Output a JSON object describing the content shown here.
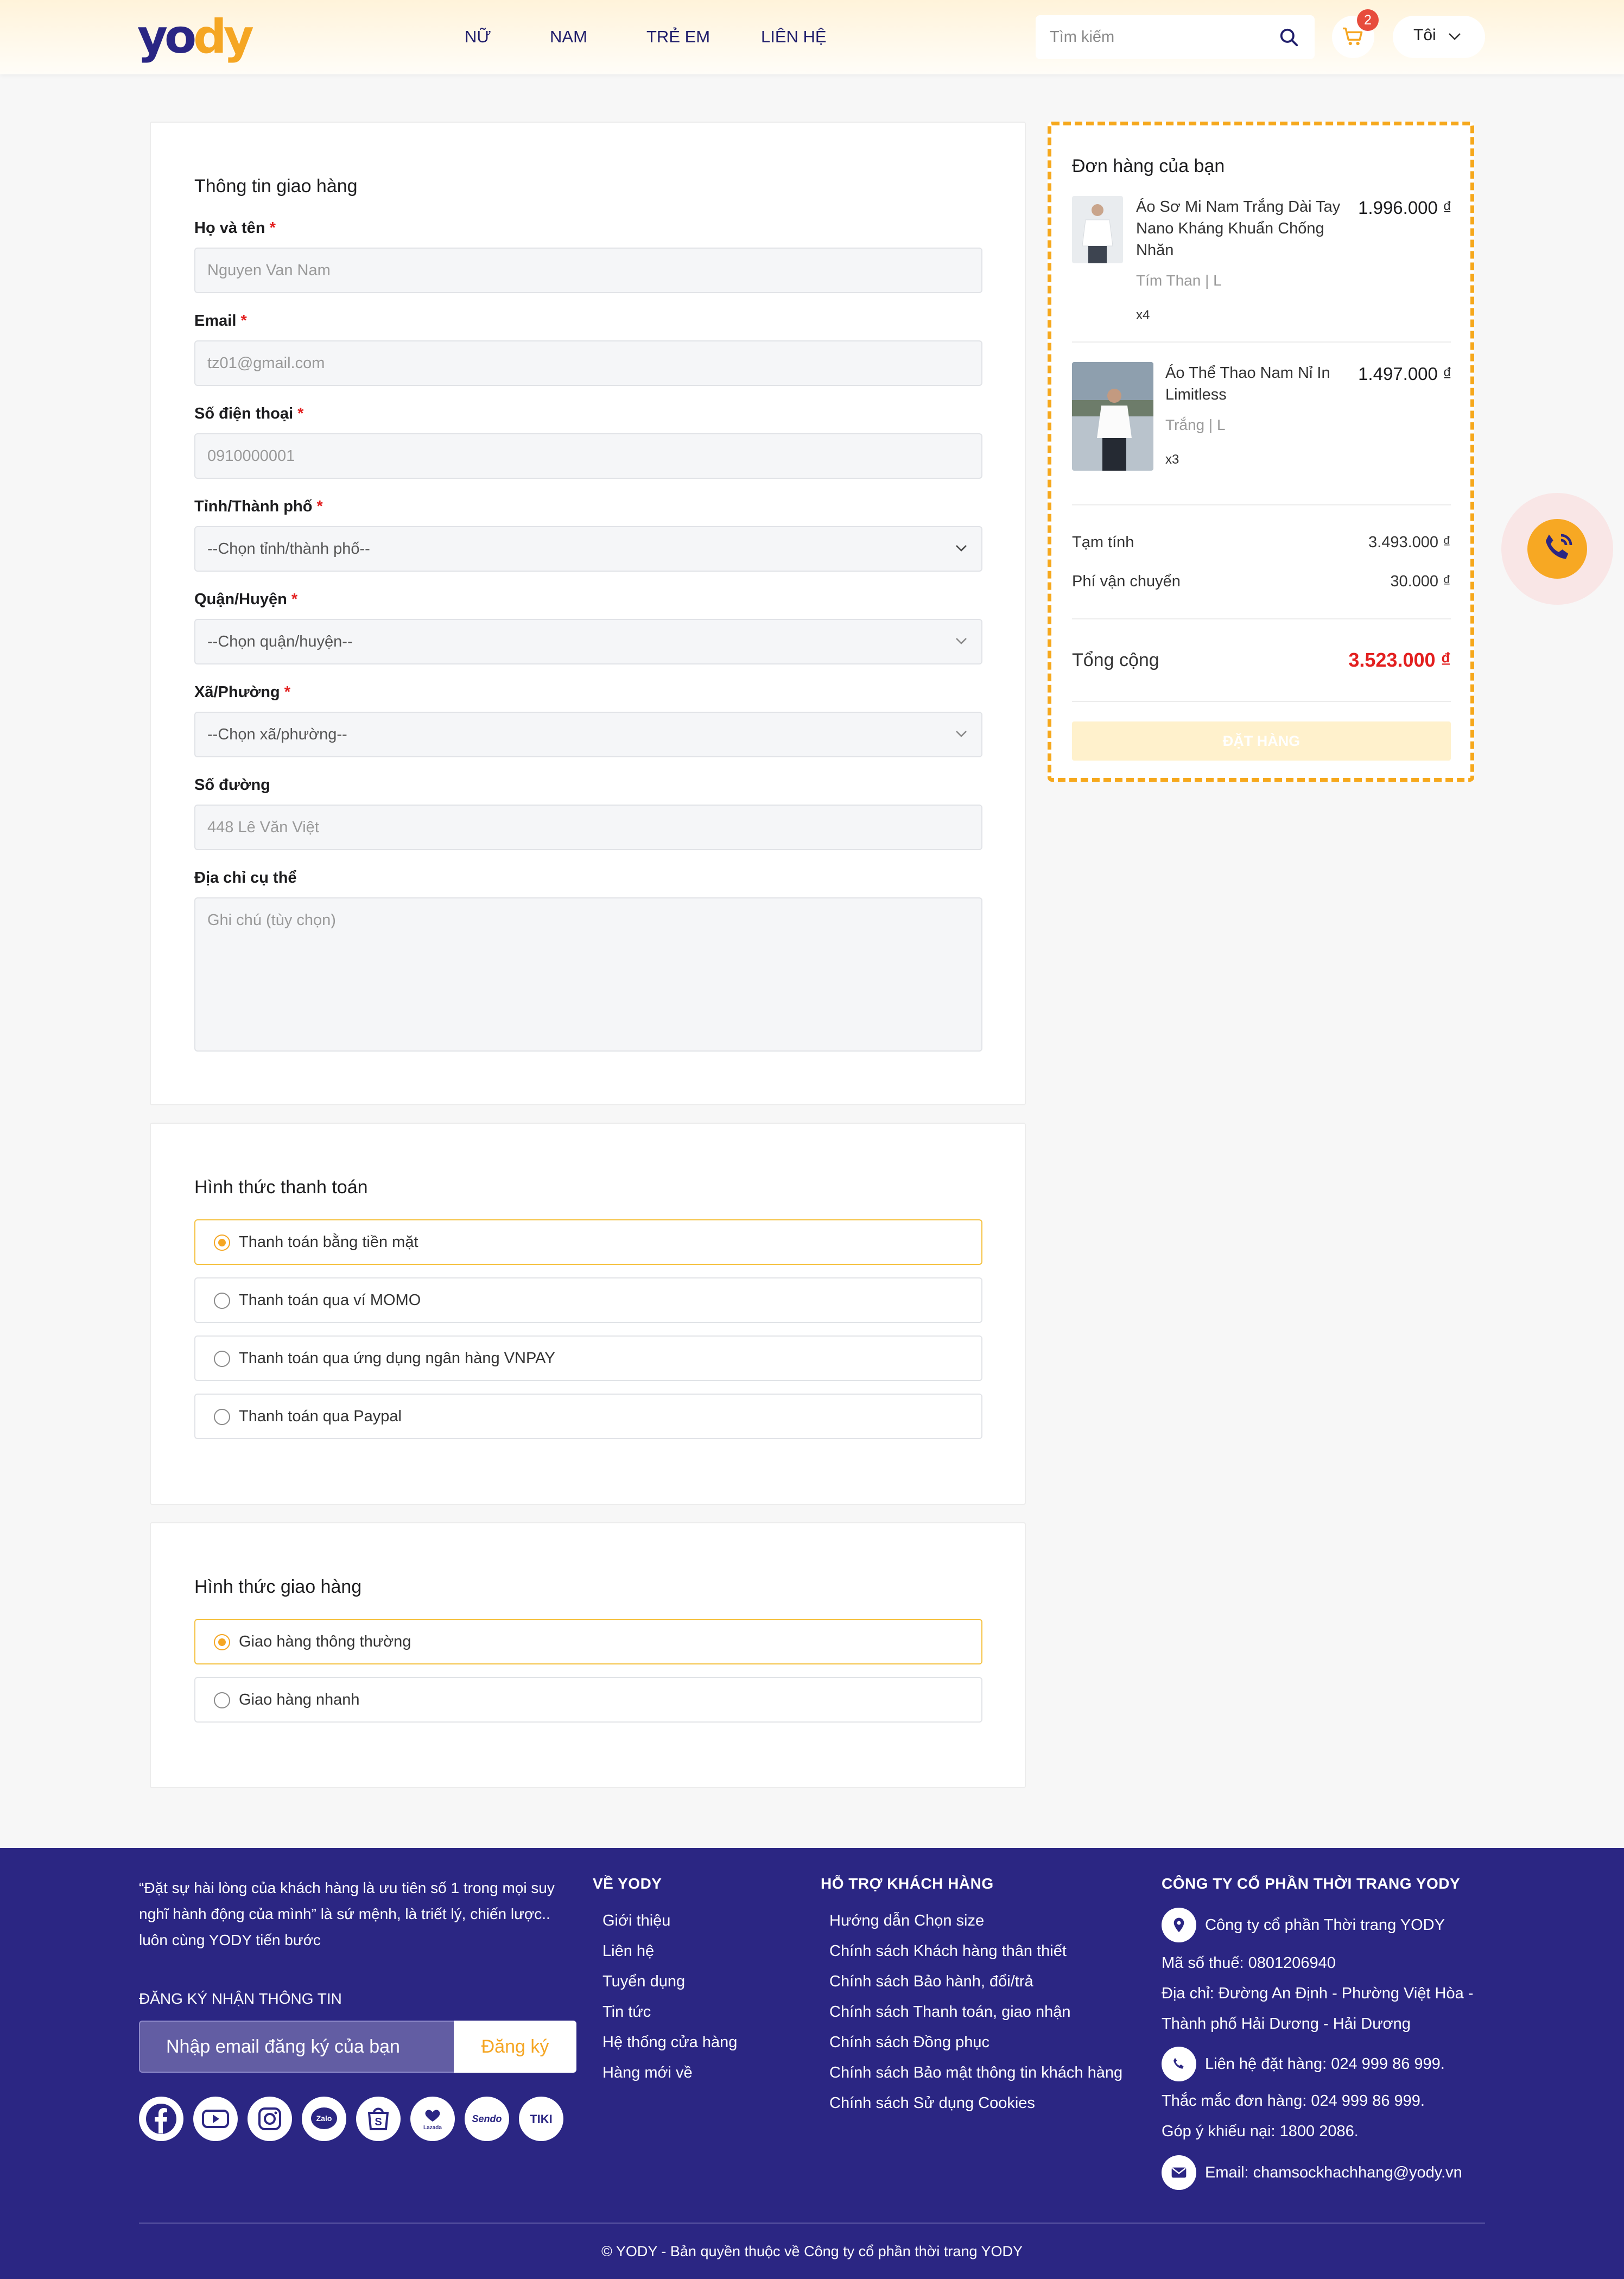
{
  "header": {
    "logo_left": "yo",
    "logo_right": "dy",
    "nav": [
      "NỮ",
      "NAM",
      "TRẺ EM",
      "LIÊN HỆ"
    ],
    "search_placeholder": "Tìm kiếm",
    "cart_count": "2",
    "user_label": "Tôi"
  },
  "shipping": {
    "title": "Thông tin giao hàng",
    "fields": [
      {
        "label": "Họ và tên",
        "value": "Nguyen Van Nam",
        "required": "*"
      },
      {
        "label": "Email",
        "value": "tz01@gmail.com",
        "required": "*"
      },
      {
        "label": "Số điện thoại",
        "value": "0910000001",
        "required": "*"
      },
      {
        "label": "Tỉnh/Thành phố",
        "value": "--Chọn tỉnh/thành phố--",
        "required": "*"
      },
      {
        "label": "Quận/Huyện",
        "value": "--Chọn quận/huyện--",
        "required": "*"
      },
      {
        "label": "Xã/Phường",
        "value": "--Chọn xã/phường--",
        "required": "*"
      },
      {
        "label": "Số đường",
        "value": "448 Lê Văn Việt"
      },
      {
        "label": "Địa chỉ cụ thể",
        "placeholder": "Ghi chú (tùy chọn)"
      }
    ]
  },
  "payment": {
    "title": "Hình thức thanh toán",
    "options": [
      "Thanh toán bằng tiền mặt",
      "Thanh toán qua ví MOMO",
      "Thanh toán qua ứng dụng ngân hàng VNPAY",
      "Thanh toán qua Paypal"
    ],
    "selected_index": 0
  },
  "delivery": {
    "title": "Hình thức giao hàng",
    "options": [
      "Giao hàng thông thường",
      "Giao hàng nhanh"
    ],
    "selected_index": 0
  },
  "order": {
    "title": "Đơn hàng của bạn",
    "items": [
      {
        "name": "Áo Sơ Mi Nam Trắng Dài Tay Nano Kháng Khuẩn Chống Nhăn",
        "variant": "Tím Than | L",
        "qty": "x4",
        "price": "1.996.000 ₫"
      },
      {
        "name": "Áo Thể Thao Nam Nỉ In Limitless",
        "variant": "Trắng | L",
        "qty": "x3",
        "price": "1.497.000 ₫"
      }
    ],
    "subtotal_label": "Tạm tính",
    "subtotal": "3.493.000 ₫",
    "shipping_label": "Phí vận chuyển",
    "shipping": "30.000 ₫",
    "total_label": "Tổng cộng",
    "total": "3.523.000 ₫",
    "button": "ĐẶT HÀNG"
  },
  "footer": {
    "quote": "“Đặt sự hài lòng của khách hàng là ưu tiên số 1 trong mọi suy nghĩ hành động của mình” là sứ mệnh, là triết lý, chiến lược.. luôn cùng YODY tiến bước",
    "subscribe_title": "ĐĂNG KÝ NHẬN THÔNG TIN",
    "subscribe_placeholder": "Nhập email đăng ký của bạn",
    "subscribe_button": "Đăng ký",
    "socials": [
      "facebook",
      "youtube",
      "instagram",
      "Zalo",
      "shopee",
      "Lazada",
      "Sendo",
      "TIKI"
    ],
    "about_title": "VỀ YODY",
    "about_links": [
      "Giới thiệu",
      "Liên hệ",
      "Tuyển dụng",
      "Tin tức",
      "Hệ thống cửa hàng",
      "Hàng mới về"
    ],
    "support_title": "HỖ TRỢ KHÁCH HÀNG",
    "support_links": [
      "Hướng dẫn Chọn size",
      "Chính sách Khách hàng thân thiết",
      "Chính sách Bảo hành, đổi/trả",
      "Chính sách Thanh toán, giao nhận",
      "Chính sách Đồng phục",
      "Chính sách Bảo mật thông tin khách hàng",
      "Chính sách Sử dụng Cookies"
    ],
    "company_title": "CÔNG TY CỔ PHẦN THỜI TRANG YODY",
    "company_name": "Công ty cổ phần Thời trang YODY",
    "tax": "Mã số thuế: 0801206940",
    "address1": "Địa chỉ: Đường An Định - Phường Việt Hòa -",
    "address2": "Thành phố Hải Dương - Hải Dương",
    "hotline": "Liên hệ đặt hàng: 024 999 86 999.",
    "inquiry": "Thắc mắc đơn hàng: 024 999 86 999.",
    "complaint": "Góp ý khiếu nại: 1800 2086.",
    "email": "Email: chamsockhachhang@yody.vn",
    "copyright": "© YODY - Bản quyền thuộc về Công ty cổ phần thời trang YODY"
  },
  "colors": {
    "brand": "#2b2683",
    "accent": "#f5a623",
    "price_red": "#e32020"
  }
}
